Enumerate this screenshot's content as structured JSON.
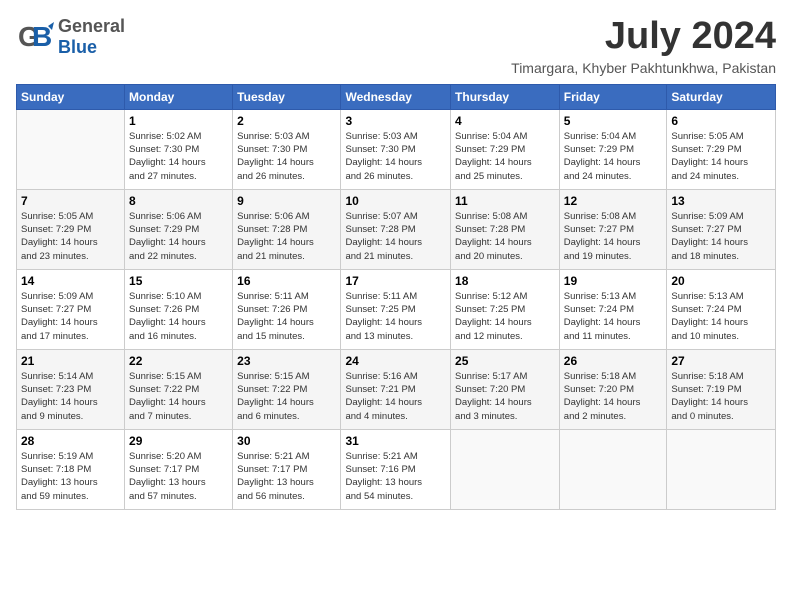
{
  "header": {
    "logo_general": "General",
    "logo_blue": "Blue",
    "title": "July 2024",
    "location": "Timargara, Khyber Pakhtunkhwa, Pakistan"
  },
  "days_of_week": [
    "Sunday",
    "Monday",
    "Tuesday",
    "Wednesday",
    "Thursday",
    "Friday",
    "Saturday"
  ],
  "weeks": [
    [
      {
        "day": "",
        "info": ""
      },
      {
        "day": "1",
        "info": "Sunrise: 5:02 AM\nSunset: 7:30 PM\nDaylight: 14 hours\nand 27 minutes."
      },
      {
        "day": "2",
        "info": "Sunrise: 5:03 AM\nSunset: 7:30 PM\nDaylight: 14 hours\nand 26 minutes."
      },
      {
        "day": "3",
        "info": "Sunrise: 5:03 AM\nSunset: 7:30 PM\nDaylight: 14 hours\nand 26 minutes."
      },
      {
        "day": "4",
        "info": "Sunrise: 5:04 AM\nSunset: 7:29 PM\nDaylight: 14 hours\nand 25 minutes."
      },
      {
        "day": "5",
        "info": "Sunrise: 5:04 AM\nSunset: 7:29 PM\nDaylight: 14 hours\nand 24 minutes."
      },
      {
        "day": "6",
        "info": "Sunrise: 5:05 AM\nSunset: 7:29 PM\nDaylight: 14 hours\nand 24 minutes."
      }
    ],
    [
      {
        "day": "7",
        "info": "Sunrise: 5:05 AM\nSunset: 7:29 PM\nDaylight: 14 hours\nand 23 minutes."
      },
      {
        "day": "8",
        "info": "Sunrise: 5:06 AM\nSunset: 7:29 PM\nDaylight: 14 hours\nand 22 minutes."
      },
      {
        "day": "9",
        "info": "Sunrise: 5:06 AM\nSunset: 7:28 PM\nDaylight: 14 hours\nand 21 minutes."
      },
      {
        "day": "10",
        "info": "Sunrise: 5:07 AM\nSunset: 7:28 PM\nDaylight: 14 hours\nand 21 minutes."
      },
      {
        "day": "11",
        "info": "Sunrise: 5:08 AM\nSunset: 7:28 PM\nDaylight: 14 hours\nand 20 minutes."
      },
      {
        "day": "12",
        "info": "Sunrise: 5:08 AM\nSunset: 7:27 PM\nDaylight: 14 hours\nand 19 minutes."
      },
      {
        "day": "13",
        "info": "Sunrise: 5:09 AM\nSunset: 7:27 PM\nDaylight: 14 hours\nand 18 minutes."
      }
    ],
    [
      {
        "day": "14",
        "info": "Sunrise: 5:09 AM\nSunset: 7:27 PM\nDaylight: 14 hours\nand 17 minutes."
      },
      {
        "day": "15",
        "info": "Sunrise: 5:10 AM\nSunset: 7:26 PM\nDaylight: 14 hours\nand 16 minutes."
      },
      {
        "day": "16",
        "info": "Sunrise: 5:11 AM\nSunset: 7:26 PM\nDaylight: 14 hours\nand 15 minutes."
      },
      {
        "day": "17",
        "info": "Sunrise: 5:11 AM\nSunset: 7:25 PM\nDaylight: 14 hours\nand 13 minutes."
      },
      {
        "day": "18",
        "info": "Sunrise: 5:12 AM\nSunset: 7:25 PM\nDaylight: 14 hours\nand 12 minutes."
      },
      {
        "day": "19",
        "info": "Sunrise: 5:13 AM\nSunset: 7:24 PM\nDaylight: 14 hours\nand 11 minutes."
      },
      {
        "day": "20",
        "info": "Sunrise: 5:13 AM\nSunset: 7:24 PM\nDaylight: 14 hours\nand 10 minutes."
      }
    ],
    [
      {
        "day": "21",
        "info": "Sunrise: 5:14 AM\nSunset: 7:23 PM\nDaylight: 14 hours\nand 9 minutes."
      },
      {
        "day": "22",
        "info": "Sunrise: 5:15 AM\nSunset: 7:22 PM\nDaylight: 14 hours\nand 7 minutes."
      },
      {
        "day": "23",
        "info": "Sunrise: 5:15 AM\nSunset: 7:22 PM\nDaylight: 14 hours\nand 6 minutes."
      },
      {
        "day": "24",
        "info": "Sunrise: 5:16 AM\nSunset: 7:21 PM\nDaylight: 14 hours\nand 4 minutes."
      },
      {
        "day": "25",
        "info": "Sunrise: 5:17 AM\nSunset: 7:20 PM\nDaylight: 14 hours\nand 3 minutes."
      },
      {
        "day": "26",
        "info": "Sunrise: 5:18 AM\nSunset: 7:20 PM\nDaylight: 14 hours\nand 2 minutes."
      },
      {
        "day": "27",
        "info": "Sunrise: 5:18 AM\nSunset: 7:19 PM\nDaylight: 14 hours\nand 0 minutes."
      }
    ],
    [
      {
        "day": "28",
        "info": "Sunrise: 5:19 AM\nSunset: 7:18 PM\nDaylight: 13 hours\nand 59 minutes."
      },
      {
        "day": "29",
        "info": "Sunrise: 5:20 AM\nSunset: 7:17 PM\nDaylight: 13 hours\nand 57 minutes."
      },
      {
        "day": "30",
        "info": "Sunrise: 5:21 AM\nSunset: 7:17 PM\nDaylight: 13 hours\nand 56 minutes."
      },
      {
        "day": "31",
        "info": "Sunrise: 5:21 AM\nSunset: 7:16 PM\nDaylight: 13 hours\nand 54 minutes."
      },
      {
        "day": "",
        "info": ""
      },
      {
        "day": "",
        "info": ""
      },
      {
        "day": "",
        "info": ""
      }
    ]
  ]
}
